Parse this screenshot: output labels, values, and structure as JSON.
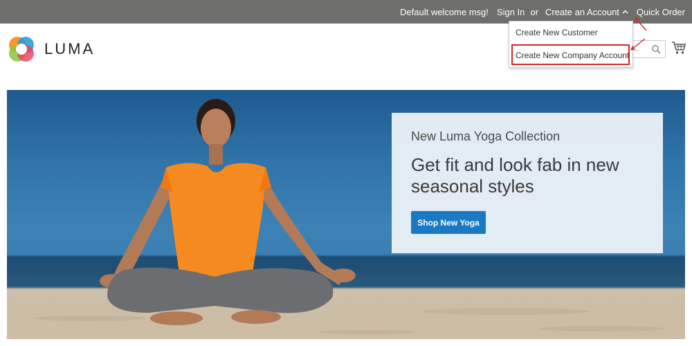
{
  "top_bar": {
    "welcome": "Default welcome msg!",
    "sign_in": "Sign In",
    "or": "or",
    "create_account": "Create an Account",
    "quick_order": "Quick Order"
  },
  "header": {
    "logo_text": "LUMA",
    "search_placeholder_visible": "..",
    "icons": {
      "search": "search-icon",
      "cart": "cart-icon",
      "logo": "luma-logo-icon"
    }
  },
  "dropdown": {
    "items": [
      {
        "label": "Create New Customer"
      },
      {
        "label": "Create New Company Account"
      }
    ]
  },
  "hero": {
    "kicker": "New Luma Yoga Collection",
    "headline": "Get fit and look fab in new seasonal styles",
    "button": "Shop New Yoga"
  },
  "colors": {
    "top_bar": "#6e6e6c",
    "button": "#1979c3",
    "highlight": "#d0262b"
  }
}
